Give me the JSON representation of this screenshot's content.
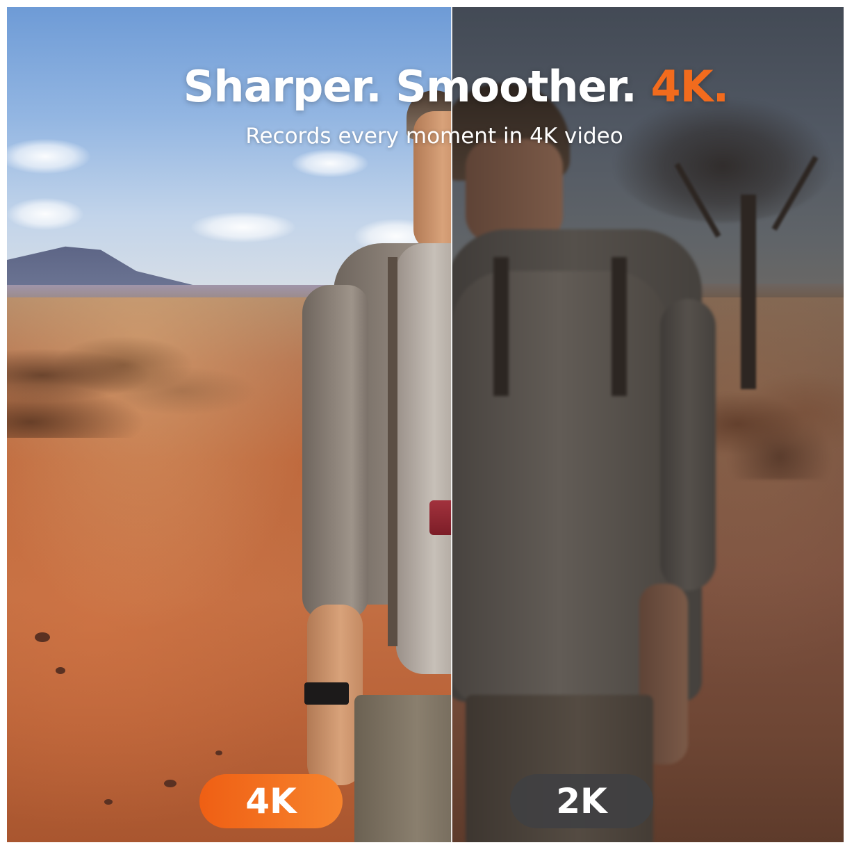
{
  "headline": {
    "part1": "Sharper. Smoother. ",
    "accent": "4K.",
    "accent_color": "#f26b1d"
  },
  "subline": "Records every moment in 4K video",
  "badges": {
    "left": {
      "label": "4K",
      "color": "#f26b1d"
    },
    "right": {
      "label": "2K",
      "color": "#404042"
    }
  }
}
